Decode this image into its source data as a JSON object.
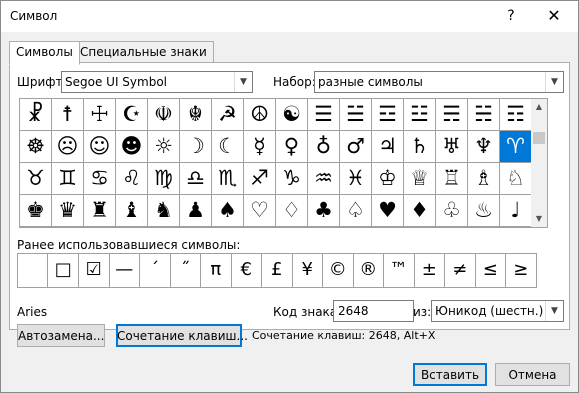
{
  "window": {
    "title": "Символ",
    "help_label": "?",
    "close_label": "✕"
  },
  "tabs": [
    {
      "label": "Символы",
      "active": true
    },
    {
      "label": "Специальные знаки",
      "active": false
    }
  ],
  "font": {
    "label": "Шрифт:",
    "value": "Segoe UI Symbol"
  },
  "subset": {
    "label": "Набор:",
    "value": "разные символы"
  },
  "symbol_grid": {
    "rows": [
      [
        "☧",
        "☨",
        "☩",
        "☪",
        "☫",
        "☬",
        "☭",
        "☮",
        "☯",
        "☰",
        "☱",
        "☲",
        "☳",
        "☴",
        "☵"
      ],
      [
        "☸",
        "☹",
        "☺",
        "☻",
        "☼",
        "☽",
        "☾",
        "☿",
        "♀",
        "♁",
        "♂",
        "♃",
        "♄",
        "♅",
        "♆",
        "♇",
        "♈"
      ],
      [
        "♉",
        "♊",
        "♋",
        "♌",
        "♍",
        "♎",
        "♏",
        "♐",
        "♑",
        "♒",
        "♓",
        "♔",
        "♕",
        "♖",
        "♗",
        "♘",
        "♙"
      ],
      [
        "♚",
        "♛",
        "♜",
        "♝",
        "♞",
        "♟",
        "♠",
        "♡",
        "♢",
        "♣",
        "♤",
        "♥",
        "♦",
        "♧",
        "♨",
        "♩",
        "♪"
      ]
    ],
    "row0": [
      "☧",
      "☨",
      "☩",
      "☪",
      "☫",
      "☬",
      "☭",
      "☮",
      "☯",
      "☰",
      "☱",
      "☲",
      "☳",
      "☴",
      "☵",
      "☶"
    ],
    "selected": "♈"
  },
  "recent": {
    "label": "Ранее использовавшиеся символы:",
    "symbols": [
      "",
      "□",
      "☑",
      "—",
      "´",
      "˝",
      "π",
      "€",
      "£",
      "¥",
      "©",
      "®",
      "™",
      "±",
      "≠",
      "≤",
      "≥"
    ]
  },
  "char_name": "Aries",
  "char_code": {
    "label": "Код знака:",
    "value": "2648"
  },
  "from": {
    "label": "из:",
    "value": "Юникод (шестн.)"
  },
  "buttons": {
    "autocorrect": "Автозамена...",
    "shortcut_key": "Сочетание клавиш...",
    "insert": "Вставить",
    "cancel": "Отмена"
  },
  "shortcut_text": "Сочетание клавиш: 2648, Alt+X"
}
